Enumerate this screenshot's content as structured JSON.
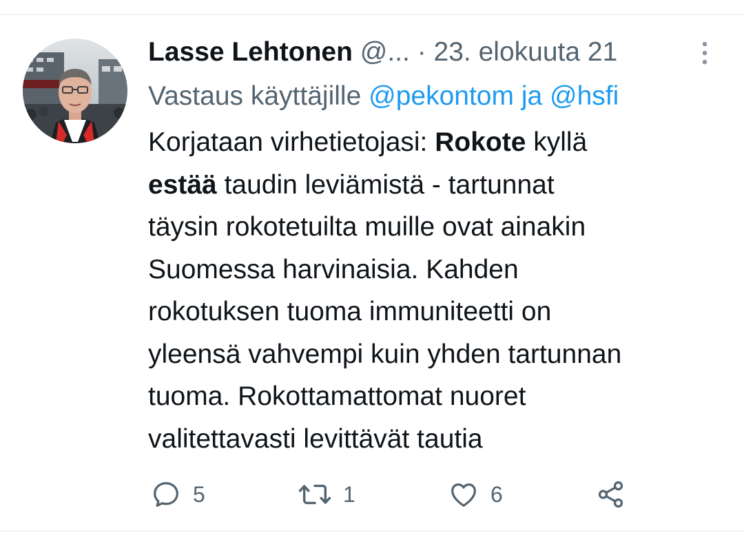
{
  "tweet": {
    "author_name": "Lasse Lehtonen",
    "author_handle": "@...",
    "separator": "·",
    "date": "23. elokuuta 21",
    "reply_prefix": "Vastaus käyttäjille",
    "reply_mention_1": "@pekontom",
    "reply_and": "ja",
    "reply_mention_2": "@hsfi",
    "text_lines": [
      [
        "Korjataan virhetietojasi: ",
        "Rokote",
        " kyllä"
      ],
      [
        "estää",
        " taudin leviämistä - tartunnat"
      ],
      [
        "täysin rokotetuilta muille ovat ainakin"
      ],
      [
        "Suomessa harvinaisia. Kahden"
      ],
      [
        "rokotuksen tuoma immuniteetti on"
      ],
      [
        "yleensä vahvempi kuin yhden tartunnan"
      ],
      [
        "tuoma. Rokottamattomat nuoret"
      ],
      [
        "valitettavasti levittävät tautia"
      ]
    ],
    "actions": {
      "reply_count": "5",
      "retweet_count": "1",
      "like_count": "6"
    }
  },
  "colors": {
    "text": "#0f1419",
    "secondary": "#536471",
    "link": "#1d9bf0",
    "divider": "#eff3f4"
  },
  "icons": [
    "more-vertical-icon",
    "reply-icon",
    "retweet-icon",
    "like-icon",
    "share-icon"
  ]
}
